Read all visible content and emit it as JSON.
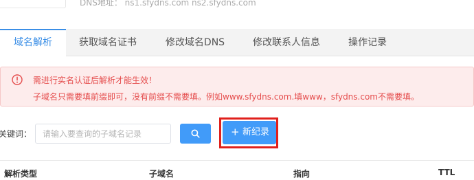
{
  "header": {
    "dns_text": "DNS地址：  ns1.sfydns.com   ns2.sfydns.com"
  },
  "tabs": [
    {
      "label": "域名解析",
      "active": true
    },
    {
      "label": "获取域名证书",
      "active": false
    },
    {
      "label": "修改域名DNS",
      "active": false
    },
    {
      "label": "修改联系人信息",
      "active": false
    },
    {
      "label": "操作记录",
      "active": false
    }
  ],
  "alert": {
    "line1": "需进行实名认证后解析才能生效！",
    "line2": "子域名只需要填前缀即可，没有前缀不需要填。例如www.sfydns.com.填www，sfydns.com不需要填。",
    "icon": "warning-circle-icon",
    "color": "#e54d4d"
  },
  "search": {
    "label": "关键词：",
    "placeholder": "请输入要查询的子域名记录",
    "value": "",
    "button_icon": "search-icon"
  },
  "add_button": {
    "plus": "+",
    "label": "新纪录"
  },
  "table": {
    "columns": [
      "解析类型",
      "子域名",
      "指向",
      "TTL"
    ]
  },
  "colors": {
    "accent": "#419bf9",
    "highlight": "#e0201c",
    "tab_active": "#3a8ee6"
  }
}
